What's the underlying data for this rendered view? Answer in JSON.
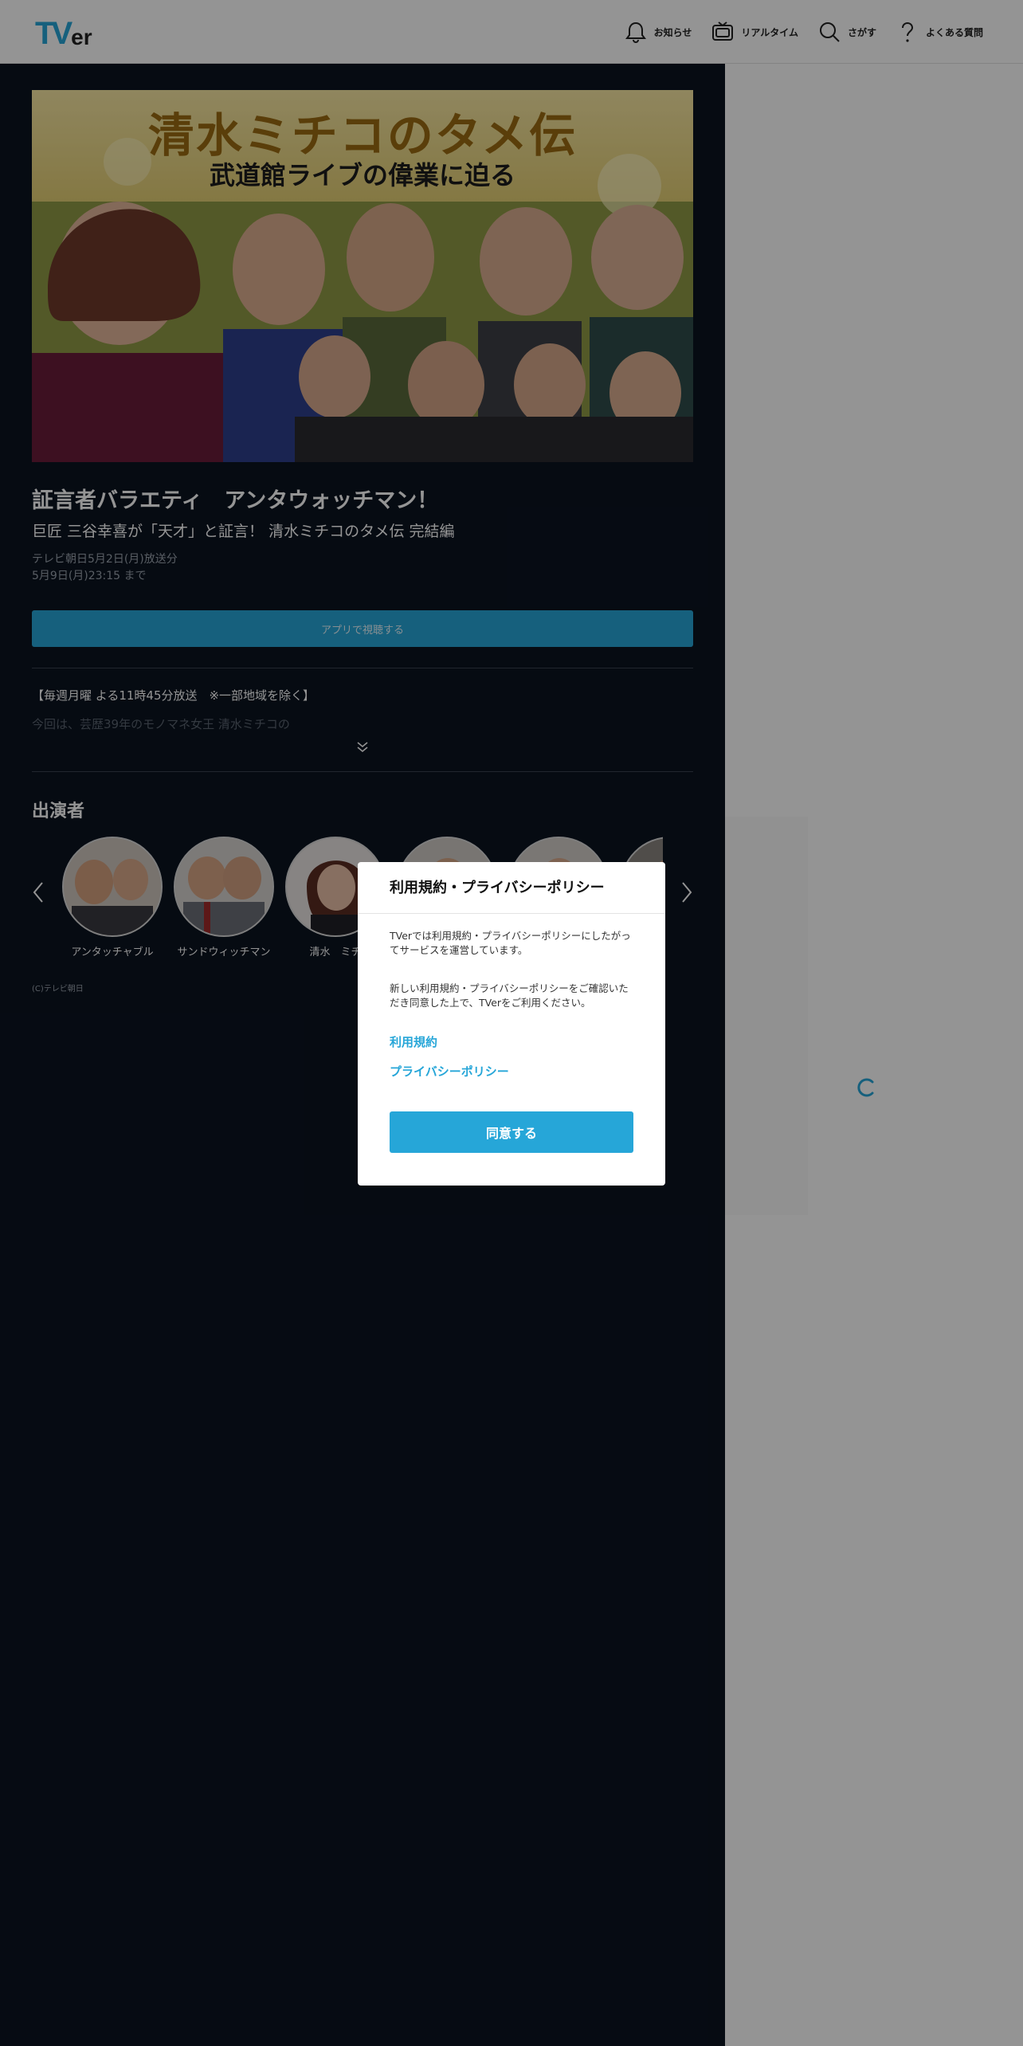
{
  "header": {
    "logo_t": "T",
    "logo_v": "V",
    "logo_er": "er",
    "nav": [
      {
        "label": "お知らせ",
        "icon": "bell-icon"
      },
      {
        "label": "リアルタイム",
        "icon": "tv-icon"
      },
      {
        "label": "さがす",
        "icon": "search-icon"
      },
      {
        "label": "よくある質問",
        "icon": "question-icon"
      }
    ]
  },
  "hero": {
    "banner_title": "清水ミチコのタメ伝",
    "banner_subtitle": "武道館ライブの偉業に迫る"
  },
  "episode": {
    "title": "証言者バラエティ　アンタウォッチマン！",
    "subtitle": "巨匠 三谷幸喜が「天才」と証言！ 清水ミチコのタメ伝 完結編",
    "broadcast_line1": "テレビ朝日5月2日(月)放送分",
    "broadcast_line2": "5月9日(月)23:15 まで",
    "watch_button": "アプリで視聴する",
    "description_line1": "【毎週月曜 よる11時45分放送　※一部地域を除く】",
    "description_line2": "今回は、芸歴39年のモノマネ女王 清水ミチコの"
  },
  "cast": {
    "heading": "出演者",
    "members": [
      {
        "name": "アンタッチャブル"
      },
      {
        "name": "サンドウィッチマン"
      },
      {
        "name": "清水　ミチ"
      },
      {
        "name": ""
      },
      {
        "name": ""
      },
      {
        "name": ""
      }
    ]
  },
  "copyright": "(C)テレビ朝日",
  "modal": {
    "title": "利用規約・プライバシーポリシー",
    "paragraph1": "TVerでは利用規約・プライバシーポリシーにしたがってサービスを運営しています。",
    "paragraph2": "新しい利用規約・プライバシーポリシーをご確認いただき同意した上で、TVerをご利用ください。",
    "link_terms": "利用規約",
    "link_privacy": "プライバシーポリシー",
    "agree_button": "同意する"
  },
  "colors": {
    "accent": "#26a6d8",
    "main_bg": "#0b1320",
    "overlay": "rgba(0,0,0,0.42)"
  }
}
